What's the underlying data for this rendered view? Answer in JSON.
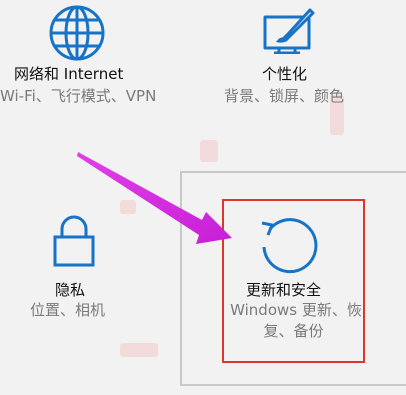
{
  "tiles": {
    "network": {
      "title": "网络和 Internet",
      "subtitle": "Wi-Fi、飞行模式、VPN",
      "icon": "globe-icon"
    },
    "personalization": {
      "title": "个性化",
      "subtitle": "背景、锁屏、颜色",
      "icon": "paint-brush-icon"
    },
    "privacy": {
      "title": "隐私",
      "subtitle": "位置、相机",
      "icon": "lock-icon"
    },
    "update": {
      "title": "更新和安全",
      "subtitle_line1": "Windows 更新、恢",
      "subtitle_line2": "复、备份",
      "icon": "refresh-icon"
    }
  },
  "colors": {
    "icon_blue": "#1673c7",
    "highlight_red": "#e0352b",
    "arrow_magenta": "#e040e8",
    "hover_border": "#c8c8c8",
    "background": "#f2f2f2"
  },
  "annotation": {
    "arrow_icon": "arrow-icon"
  }
}
